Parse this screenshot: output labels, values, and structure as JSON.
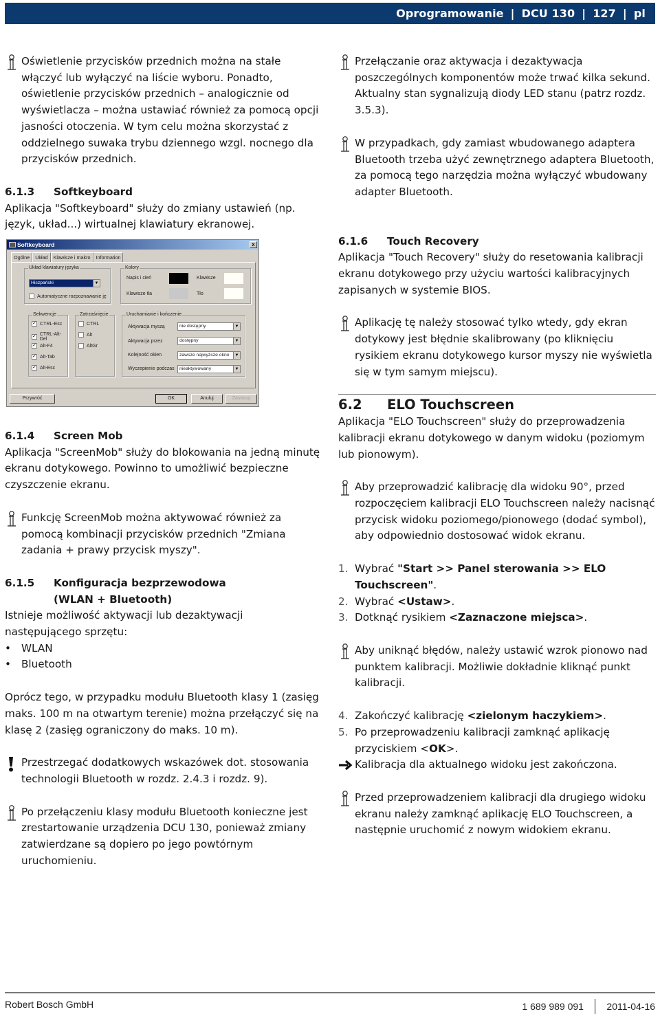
{
  "header": {
    "section": "Oprogramowanie",
    "product": "DCU 130",
    "page": "127",
    "lang": "pl",
    "separator": "|"
  },
  "left": {
    "note1": "Oświetlenie przycisków przednich można na stałe włączyć lub wyłączyć na liście wyboru. Ponadto, oświetlenie przycisków przednich – analogicznie od wyświetlacza – można ustawiać również za pomocą opcji jasności otoczenia. W tym celu można skorzystać z oddzielnego suwaka trybu dziennego wzgl. nocnego dla przycisków przednich.",
    "s613": {
      "num": "6.1.3",
      "title": "Softkeyboard",
      "body": "Aplikacja \"Softkeyboard\" służy do zmiany ustawień (np. język, układ...) wirtualnej klawiatury ekranowej."
    },
    "s614": {
      "num": "6.1.4",
      "title": "Screen Mob",
      "body": "Aplikacja \"ScreenMob\" służy do blokowania na jedną minutę ekranu dotykowego. Powinno to umożliwić bezpieczne czyszczenie ekranu."
    },
    "note2": "Funkcję ScreenMob można aktywować również za pomocą kombinacji przycisków przednich \"Zmiana zadania + prawy przycisk myszy\".",
    "s615": {
      "num": "6.1.5",
      "title_line1": "Konfiguracja bezprzewodowa",
      "title_line2": "(WLAN + Bluetooth)",
      "body": "Istnieje możliwość aktywacji lub dezaktywacji następującego sprzętu:",
      "bullets": [
        "WLAN",
        "Bluetooth"
      ],
      "body2": "Oprócz tego, w przypadku modułu Bluetooth klasy 1 (zasięg maks. 100 m na otwartym terenie) można przełączyć się na klasę 2 (zasięg ograniczony do maks. 10 m)."
    },
    "warning": "Przestrzegać dodatkowych wskazówek dot. stosowania technologii Bluetooth w rozdz. 2.4.3 i rozdz. 9).",
    "note3": "Po przełączeniu klasy modułu Bluetooth konieczne jest zrestartowanie urządzenia DCU 130, ponieważ zmiany zatwierdzane są dopiero po jego powtórnym uruchomieniu."
  },
  "dialog": {
    "title": "Softkeyboard",
    "close": "x",
    "tabs": [
      "Ogólne",
      "Układ",
      "Klawisze i makro",
      "Information"
    ],
    "layout_group": "Układ klawiatury języka",
    "language_value": "Hiszpański",
    "auto_detect_label": "Automatyczne rozpoznawanie ję",
    "auto_detect_checked": false,
    "colors_group": "Kolory",
    "colors": [
      {
        "label": "Napis i cień",
        "color": "#000000"
      },
      {
        "label": "Klawisze",
        "color": "#fffff8"
      },
      {
        "label": "Klawisze tła",
        "color": "#c8c8c8"
      },
      {
        "label": "Tło",
        "color": "#fffff8"
      }
    ],
    "sequences_group": "Sekwencje",
    "sequences": [
      {
        "label": "CTRL-Esc",
        "checked": true
      },
      {
        "label": "CTRL-Alt-Del",
        "checked": true
      },
      {
        "label": "Alt-F4",
        "checked": true
      },
      {
        "label": "Alt-Tab",
        "checked": true
      },
      {
        "label": "Alt-Esc",
        "checked": true
      }
    ],
    "latch_group": "Zatrzaśnięcie",
    "latch": [
      {
        "label": "CTRL",
        "checked": false
      },
      {
        "label": "Alt",
        "checked": false
      },
      {
        "label": "AltGr",
        "checked": false
      }
    ],
    "startup_group": "Uruchamianie i kończenie",
    "startup": [
      {
        "label": "Aktywacja myszą",
        "value": "nie dostępny"
      },
      {
        "label": "Aktywacja przez",
        "value": "dostępny"
      },
      {
        "label": "Kolejność okien",
        "value": "zawsze najwyższe okno"
      },
      {
        "label": "Wyczepienie podczas",
        "value": "nieaktywowany"
      }
    ],
    "buttons": {
      "restore": "Przywróć",
      "ok": "OK",
      "cancel": "Anuluj",
      "apply": "Zastosuj"
    },
    "check_glyph": "✓",
    "dropdown_glyph": "▼"
  },
  "right": {
    "note1": "Przełączanie oraz aktywacja i dezaktywacja poszczególnych komponentów może trwać kilka sekund. Aktualny stan sygnalizują diody LED stanu (patrz rozdz. 3.5.3).",
    "note2": "W przypadkach, gdy zamiast wbudowanego adaptera Bluetooth trzeba użyć zewnętrznego adaptera Bluetooth, za pomocą tego narzędzia można wyłączyć wbudowany adapter Bluetooth.",
    "s616": {
      "num": "6.1.6",
      "title": "Touch Recovery",
      "body": "Aplikacja \"Touch Recovery\" służy do resetowania kalibracji ekranu dotykowego przy użyciu wartości kalibracyjnych zapisanych w systemie BIOS."
    },
    "note3": "Aplikację tę należy stosować tylko wtedy, gdy ekran dotykowy jest błędnie skalibrowany (po kliknięciu rysikiem ekranu dotykowego kursor myszy nie wyświetla się w tym samym miejscu).",
    "s62": {
      "num": "6.2",
      "title": "ELO Touchscreen",
      "body": "Aplikacja \"ELO Touchscreen\" służy do przeprowadzenia kalibracji ekranu dotykowego w danym widoku (poziomym lub pionowym)."
    },
    "note4": "Aby przeprowadzić kalibrację dla widoku 90°, przed rozpoczęciem kalibracji ELO Touchscreen należy nacisnąć przycisk widoku poziomego/pionowego (dodać symbol), aby odpowiednio dostosować widok ekranu.",
    "steps_a": [
      {
        "n": "1.",
        "pre": "Wybrać ",
        "bold": "\"Start >> Panel sterowania >> ELO Touchscreen\"",
        "post": "."
      },
      {
        "n": "2.",
        "pre": "Wybrać ",
        "bold": "<Ustaw>",
        "post": "."
      },
      {
        "n": "3.",
        "pre": "Dotknąć rysikiem ",
        "bold": "<Zaznaczone miejsca>",
        "post": "."
      }
    ],
    "note5": "Aby uniknąć błędów, należy ustawić wzrok pionowo nad punktem kalibracji. Możliwie dokładnie kliknąć punkt kalibracji.",
    "steps_b": [
      {
        "n": "4.",
        "pre": "Zakończyć kalibrację ",
        "bold": "<zielonym haczykiem>",
        "post": "."
      },
      {
        "n": "5.",
        "pre": "Po przeprowadzeniu kalibracji zamknąć aplikację przyciskiem <",
        "bold": "OK",
        "post": ">."
      }
    ],
    "result": "Kalibracja dla aktualnego widoku jest zakończona.",
    "note6": "Przed przeprowadzeniem kalibracji dla drugiego widoku ekranu należy zamknąć aplikację ELO Touchscreen, a następnie uruchomić z nowym widokiem ekranu."
  },
  "footer": {
    "company": "Robert Bosch GmbH",
    "doc_number": "1 689 989 091",
    "date": "2011-04-16"
  },
  "colors": {
    "header_bg": "#0d3a6e",
    "header_text": "#ffffff"
  }
}
